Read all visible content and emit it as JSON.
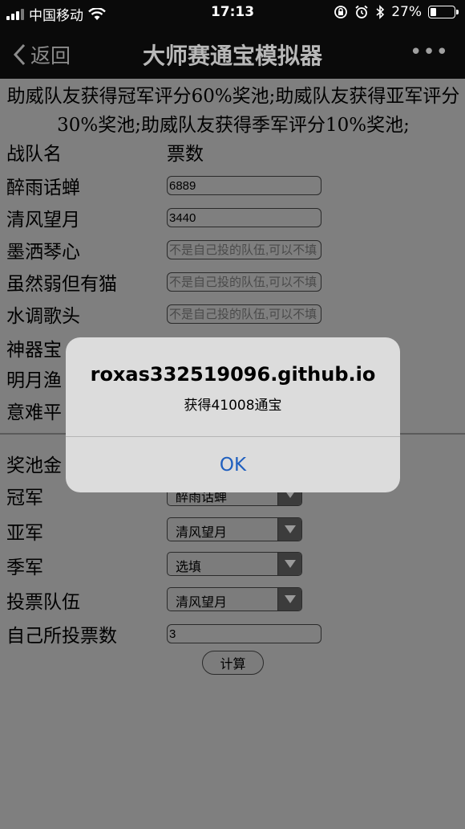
{
  "status_bar": {
    "carrier": "中国移动",
    "time": "17:13",
    "battery": "27%",
    "battery_level": 27
  },
  "nav": {
    "back_label": "返回",
    "title": "大师赛通宝模拟器",
    "more_label": "•••"
  },
  "description": "助威队友获得冠军评分60%奖池;助威队友获得亚军评分30%奖池;助威队友获得季军评分10%奖池;",
  "team_table": {
    "header_team": "战队名",
    "header_votes": "票数",
    "rows": [
      {
        "name": "醉雨话蝉",
        "value": "6889",
        "placeholder": ""
      },
      {
        "name": "清风望月",
        "value": "3440",
        "placeholder": ""
      },
      {
        "name": "墨洒琴心",
        "value": "",
        "placeholder": "不是自己投的队伍,可以不填"
      },
      {
        "name": "虽然弱但有猫",
        "value": "",
        "placeholder": "不是自己投的队伍,可以不填"
      },
      {
        "name": "水调歌头",
        "value": "",
        "placeholder": "不是自己投的队伍,可以不填"
      },
      {
        "name": "神器宝",
        "value": "",
        "placeholder": ""
      },
      {
        "name": "明月渔",
        "value": "",
        "placeholder": ""
      },
      {
        "name": "意难平",
        "value": "",
        "placeholder": ""
      }
    ]
  },
  "form": {
    "pool_label": "奖池金",
    "champion_label": "冠军",
    "champion_value": "醉雨话蝉",
    "runner_up_label": "亚军",
    "runner_up_value": "清风望月",
    "third_label": "季军",
    "third_value": "选填",
    "vote_team_label": "投票队伍",
    "vote_team_value": "清风望月",
    "own_votes_label": "自己所投票数",
    "own_votes_value": "3",
    "calc_label": "计算"
  },
  "alert": {
    "title": "roxas332519096.github.io",
    "message": "获得41008通宝",
    "ok_label": "OK"
  },
  "colors": {
    "link_blue": "#1f5fbf",
    "overlay_gray": "#7f7f7f"
  }
}
